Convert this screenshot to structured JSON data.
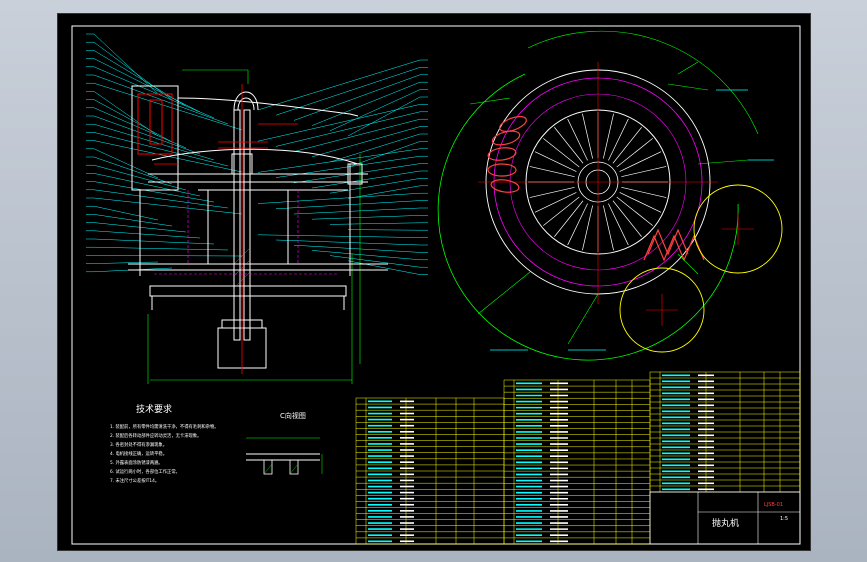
{
  "notes": {
    "heading": "技术要求",
    "items": [
      "1. 装配前，所有零件均需清洗干净，不得有毛刺和杂物。",
      "2. 装配后各转动部件应转动灵活，无卡滞现象。",
      "3. 各密封处不得有渗漏现象。",
      "4. 电机接线正确，运转平稳。",
      "5. 外露表面涂防锈漆两遍。",
      "6. 试运行两小时，各部位工作正常。",
      "7. 未注尺寸公差按IT14。"
    ]
  },
  "detail_label": "C向视图",
  "title_block": {
    "title": "抛丸机",
    "drawing_no": "LJSB-01",
    "scale": "1:5"
  },
  "colors": {
    "background": "#000000",
    "outline": "#ffffff",
    "leader": "#00ffff",
    "dimension": "#00ff00",
    "center_line": "#ff0000",
    "hidden": "#ff00ff",
    "table_line": "#ffff00"
  }
}
